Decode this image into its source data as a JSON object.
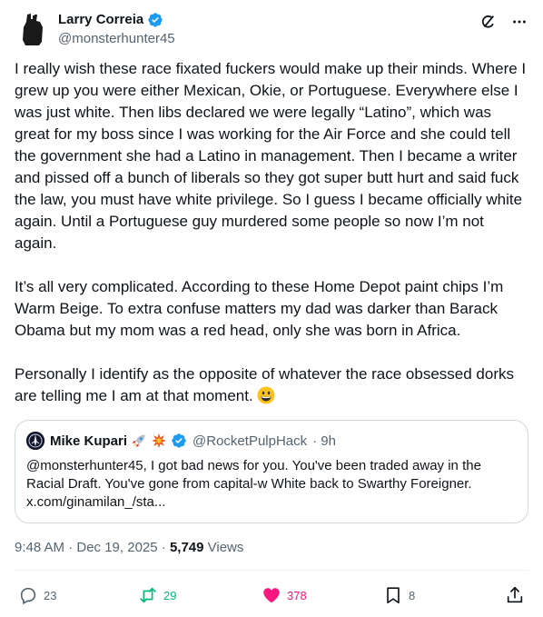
{
  "author": {
    "name": "Larry Correia",
    "handle": "@monsterhunter45"
  },
  "tweet": {
    "paragraphs": [
      "I really wish these race fixated fuckers would make up their minds. Where I grew up you were either Mexican, Okie, or Portuguese. Everywhere else I was just white. Then libs declared we were legally “Latino”, which was great for my boss since I was working for the Air Force and she could tell the government she had a Latino in management. Then I became a writer and pissed off a bunch of liberals so they got super butt hurt and said fuck the law, you must have white privilege. So I guess I became officially white again. Until a Portuguese guy murdered some people so now I’m not again.",
      "It’s all very complicated. According to these Home Depot paint chips I’m Warm Beige. To extra confuse matters my dad was darker than Barack Obama but my mom was a red head, only she was born in Africa.",
      "Personally I identify as the opposite of whatever the race obsessed dorks are telling me I am at that moment."
    ]
  },
  "quote": {
    "name": "Mike Kupari",
    "handle": "@RocketPulpHack",
    "time": "· 9h",
    "text": "@monsterhunter45, I got bad news for you. You've been traded away in the Racial Draft. You've gone from capital-w White back to Swarthy Foreigner. x.com/ginamilan_/sta..."
  },
  "meta": {
    "time": "9:48 AM · Dec 19, 2025 · ",
    "views_count": "5,749",
    "views_label": " Views"
  },
  "actions": {
    "replies": "23",
    "reposts": "29",
    "likes": "378",
    "bookmarks": "8"
  },
  "colors": {
    "verified": "#1d9bf0",
    "repost": "#00ba7c",
    "like": "#f91880",
    "secondary_text": "#536471"
  },
  "icons": [
    "verified-badge-icon",
    "grok-icon",
    "more-icon",
    "reply-icon",
    "repost-icon",
    "like-icon",
    "bookmark-icon",
    "share-icon",
    "rocket-emoji",
    "collision-emoji",
    "grinning-emoji"
  ]
}
